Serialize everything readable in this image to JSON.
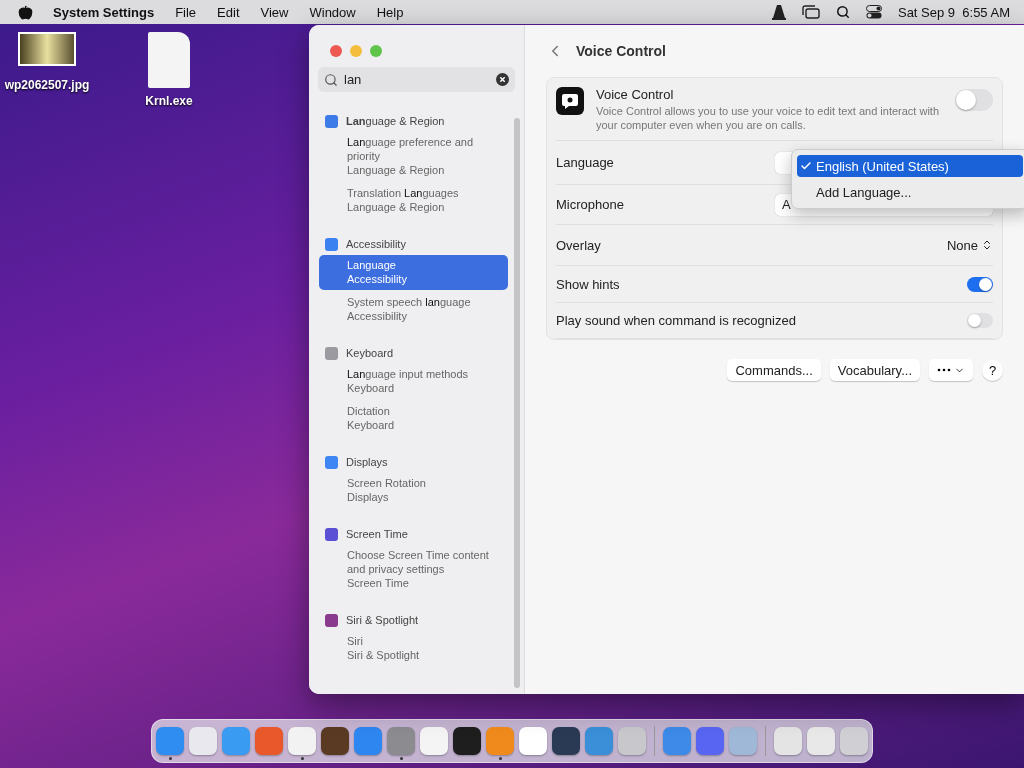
{
  "menubar": {
    "app_name": "System Settings",
    "menus": [
      "File",
      "Edit",
      "View",
      "Window",
      "Help"
    ],
    "clock": "Sat Sep 9  6:55 AM"
  },
  "desktop_icons": [
    {
      "kind": "image",
      "label": "wp2062507.jpg"
    },
    {
      "kind": "file",
      "label": "Krnl.exe"
    }
  ],
  "window": {
    "search": {
      "value": "lan"
    },
    "results": [
      {
        "title": "**Lan**guage & Region",
        "color": "#3d7be8",
        "items": [
          {
            "title": "**Lan**guage preference and priority",
            "subtitle": "Language & Region",
            "selected": false
          },
          {
            "title": "Translation **Lan**guages",
            "subtitle": "Language & Region",
            "selected": false
          }
        ]
      },
      {
        "title": "Accessibility",
        "color": "#3b82f0",
        "items": [
          {
            "title": "**Lan**guage",
            "subtitle": "Accessibility",
            "selected": true
          },
          {
            "title": "System speech **lan**guage",
            "subtitle": "Accessibility",
            "selected": false
          }
        ]
      },
      {
        "title": "Keyboard",
        "color": "#9a9aa0",
        "items": [
          {
            "title": "**Lan**guage input methods",
            "subtitle": "Keyboard",
            "selected": false
          },
          {
            "title": "Dictation",
            "subtitle": "Keyboard",
            "selected": false
          }
        ]
      },
      {
        "title": "Displays",
        "color": "#3f86f5",
        "items": [
          {
            "title": "Screen Rotation",
            "subtitle": "Displays",
            "selected": false
          }
        ]
      },
      {
        "title": "Screen Time",
        "color": "#5b4fd6",
        "items": [
          {
            "title": "Choose Screen Time content and privacy settings",
            "subtitle": "Screen Time",
            "selected": false
          }
        ]
      },
      {
        "title": "Siri & Spotlight",
        "color": "#8a3a8f",
        "items": [
          {
            "title": "Siri",
            "subtitle": "Siri & Spotlight",
            "selected": false
          }
        ]
      }
    ],
    "detail": {
      "title": "Voice Control",
      "feature": {
        "title": "Voice Control",
        "description": "Voice Control allows you to use your voice to edit text and interact with your computer even when you are on calls.",
        "on": false
      },
      "rows": [
        {
          "kind": "popup",
          "label": "Language",
          "value": ""
        },
        {
          "kind": "popup",
          "label": "Microphone",
          "value": "A"
        },
        {
          "kind": "stepper",
          "label": "Overlay",
          "value": "None"
        },
        {
          "kind": "toggle",
          "label": "Show hints",
          "on": true
        },
        {
          "kind": "toggle",
          "label": "Play sound when command is recognized",
          "on": false
        }
      ],
      "menu": [
        {
          "label": "English (United States)",
          "selected": true
        },
        {
          "label": "Add Language...",
          "selected": false
        }
      ],
      "buttons": [
        "Commands...",
        "Vocabulary..."
      ],
      "help": "?"
    }
  },
  "dock": [
    {
      "kind": "app",
      "color": "#2f8cf0",
      "running": true
    },
    {
      "kind": "app",
      "color": "#e8e8ee",
      "running": false
    },
    {
      "kind": "app",
      "color": "#3a9bf2",
      "running": false
    },
    {
      "kind": "app",
      "color": "#e8582a",
      "running": false
    },
    {
      "kind": "app",
      "color": "#f2f2f2",
      "running": true
    },
    {
      "kind": "app",
      "color": "#5a3a22",
      "running": false
    },
    {
      "kind": "app",
      "color": "#2e86f0",
      "running": false
    },
    {
      "kind": "app",
      "color": "#8c8c90",
      "running": true
    },
    {
      "kind": "app",
      "color": "#f4f4f4",
      "running": false
    },
    {
      "kind": "app",
      "color": "#1e1e1e",
      "running": false
    },
    {
      "kind": "app",
      "color": "#f08a1c",
      "running": true
    },
    {
      "kind": "app",
      "color": "#ffffff",
      "running": false
    },
    {
      "kind": "app",
      "color": "#2a3a55",
      "running": false
    },
    {
      "kind": "app",
      "color": "#3a8fd8",
      "running": false
    },
    {
      "kind": "app",
      "color": "#c8c8cc",
      "running": false
    },
    {
      "kind": "separator"
    },
    {
      "kind": "app",
      "color": "#3d8ae8",
      "running": false
    },
    {
      "kind": "app",
      "color": "#5865f2",
      "running": false
    },
    {
      "kind": "app",
      "color": "#9fb8d8",
      "running": false
    },
    {
      "kind": "separator"
    },
    {
      "kind": "app",
      "color": "#e4e4e4",
      "running": false
    },
    {
      "kind": "app",
      "color": "#e8e8e8",
      "running": false
    },
    {
      "kind": "app",
      "color": "#d0d0d4",
      "running": false
    }
  ]
}
